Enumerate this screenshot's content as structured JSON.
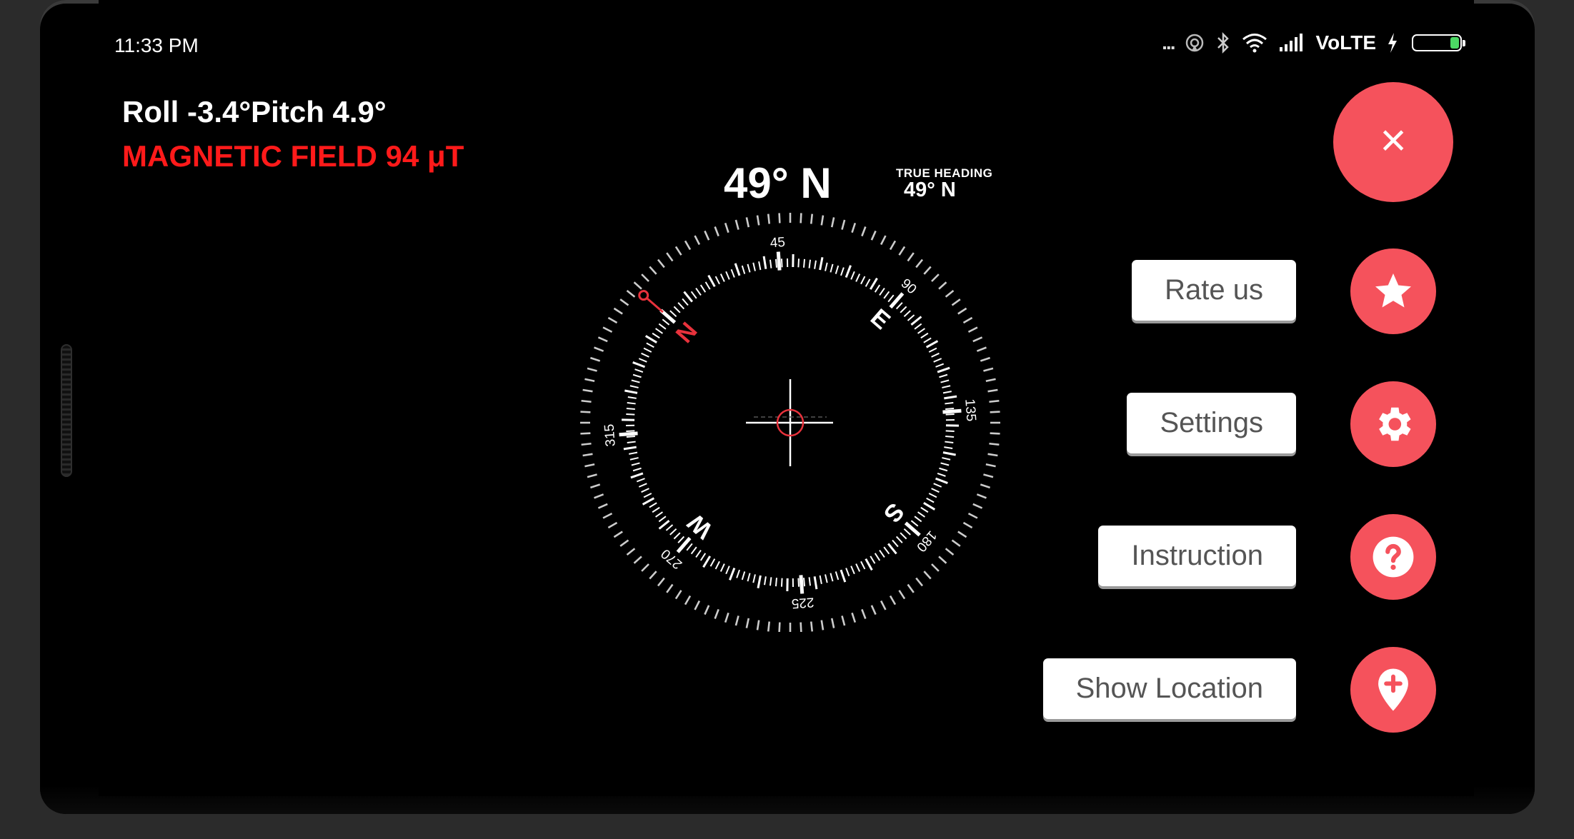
{
  "status_bar": {
    "time": "11:33 PM",
    "dots": "...",
    "network": "VoLTE",
    "battery_fill_fraction": 0.2
  },
  "readout": {
    "roll_pitch": "Roll -3.4°Pitch 4.9°",
    "magnetic_field": "MAGNETIC FIELD  94 μT"
  },
  "heading": {
    "value": "49° N",
    "true_label": "TRUE HEADING",
    "true_value": "49° N"
  },
  "compass": {
    "rotation_deg": 49,
    "degree_labels": [
      "45",
      "90",
      "135",
      "180",
      "225",
      "270",
      "315"
    ],
    "cardinals": {
      "N": "N",
      "E": "E",
      "S": "S",
      "W": "W"
    },
    "accent": "#e8323c"
  },
  "fab_menu": {
    "close_icon": "×",
    "items": [
      {
        "label": "Rate us",
        "icon": "star-icon"
      },
      {
        "label": "Settings",
        "icon": "gear-icon"
      },
      {
        "label": "Instruction",
        "icon": "question-icon"
      },
      {
        "label": "Show Location",
        "icon": "location-pin-icon"
      }
    ],
    "color": "#f5525c"
  }
}
